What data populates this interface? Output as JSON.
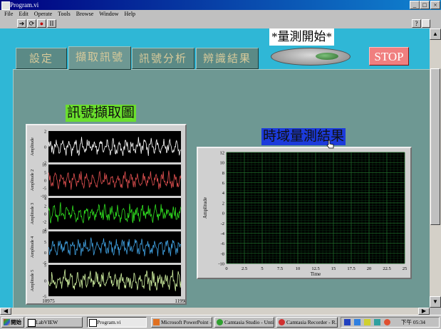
{
  "window": {
    "title": "Program.vi",
    "min": "_",
    "max": "□",
    "close": "×"
  },
  "menu": [
    "File",
    "Edit",
    "Operate",
    "Tools",
    "Browse",
    "Window",
    "Help"
  ],
  "tabs": [
    {
      "label": "設定"
    },
    {
      "label": "擷取訊號"
    },
    {
      "label": "訊號分析"
    },
    {
      "label": "辨識結果"
    }
  ],
  "controls": {
    "start_label": "*量測開始*",
    "stop_label": "STOP"
  },
  "colors": {
    "panel": "#2fb7d6",
    "tab_body": "#6e9893",
    "plot_bg": "#000000",
    "grid": "#1f6b2a"
  },
  "chart_data": [
    {
      "type": "line",
      "title": "訊號擷取圖",
      "xlabel": "Time",
      "x_ticks": [
        "10975",
        "11998"
      ],
      "series": [
        {
          "name": "Amplitude",
          "color": "#ffffff",
          "ylim": [
            -2,
            2
          ],
          "y_ticks": [
            "2",
            "0",
            "-2"
          ]
        },
        {
          "name": "Amplitude 2",
          "color": "#e05050",
          "ylim": [
            -10,
            10
          ],
          "y_ticks": [
            "10",
            "5",
            "0",
            "-5",
            "-10"
          ]
        },
        {
          "name": "Amplitude 3",
          "color": "#30e020",
          "ylim": [
            -4,
            4
          ],
          "y_ticks": [
            "4",
            "2",
            "0",
            "-2",
            "-4"
          ]
        },
        {
          "name": "Amplitude 4",
          "color": "#40a0e0",
          "ylim": [
            -10,
            10
          ],
          "y_ticks": [
            "10",
            "5",
            "0",
            "-5"
          ]
        },
        {
          "name": "Amplitude 5",
          "color": "#d0f0a0",
          "ylim": [
            -5,
            5
          ],
          "y_ticks": [
            "5",
            "0",
            "-5"
          ]
        }
      ]
    },
    {
      "type": "line",
      "title": "時域量測結果",
      "xlabel": "Time",
      "ylabel": "Amplitude",
      "xlim": [
        0,
        25
      ],
      "ylim": [
        -10,
        12
      ],
      "x_ticks": [
        "0",
        "2.5",
        "5",
        "7.5",
        "10",
        "12.5",
        "15",
        "17.5",
        "20",
        "22.5",
        "25"
      ],
      "y_ticks": [
        "12",
        "10",
        "8",
        "6",
        "4",
        "2",
        "0",
        "-2",
        "-4",
        "-6",
        "-8",
        "-10"
      ],
      "grid": true,
      "series": []
    }
  ],
  "taskbar": {
    "start": "開始",
    "tasks": [
      "LabVIEW",
      "Program.vi",
      "Microsoft PowerPoint -...",
      "Camtasia Studio - Untit...",
      "Camtasia Recorder - R..."
    ],
    "clock": "下午 05:34"
  }
}
